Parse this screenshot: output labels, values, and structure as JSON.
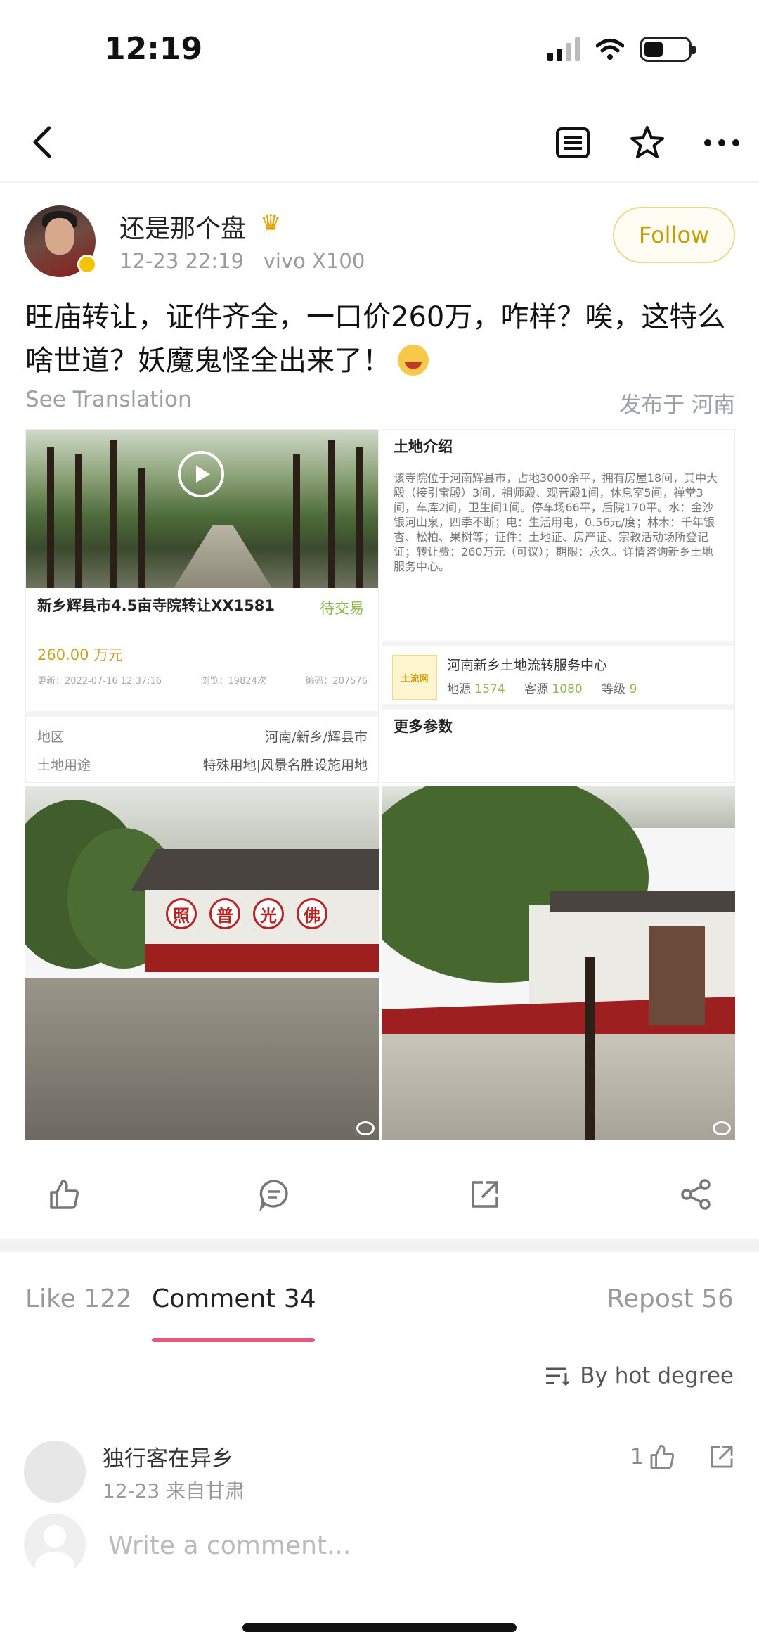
{
  "status_bar": {
    "time": "12:19"
  },
  "nav": {
    "back_icon": "chevron-left-icon",
    "icons": [
      "list-icon",
      "star-icon",
      "more-icon"
    ]
  },
  "author": {
    "name": "还是那个盘",
    "timestamp": "12-23 22:19",
    "device": "vivo X100",
    "follow_label": "Follow"
  },
  "post": {
    "text": "旺庙转让，证件齐全，一口价260万，咋样？唉，这特么啥世道？妖魔鬼怪全出来了！",
    "see_translation": "See Translation",
    "published_in": "发布于 河南"
  },
  "listing": {
    "title": "新乡辉县市4.5亩寺院转让XX1581",
    "status": "待交易",
    "price": "260.00 万元",
    "updated": "更新：2022-07-16 12:37:16",
    "views": "浏览：19824次",
    "code": "编码：207576",
    "region_label": "地区",
    "region_value": "河南/新乡/辉县市",
    "use_label": "土地用途",
    "use_value": "特殊用地|风景名胜设施用地"
  },
  "land_info": {
    "title": "土地介绍",
    "body": "该寺院位于河南辉县市，占地3000余平，拥有房屋18间，其中大殿（接引宝殿）3间，祖师殿、观音殿1间，休息室5间，禅堂3间，车库2间，卫生间1间。停车场66平，后院170平。水：金沙银河山泉，四季不断；电：生活用电，0.56元/度；林木：千年银杏、松柏、果树等；证件：土地证、房产证、宗教活动场所登记证；转让费：260万元（可议）；期限：永久。详情咨询新乡土地服务中心。",
    "center_logo": "土流网",
    "center_name": "河南新乡土地流转服务中心",
    "source_label": "地源",
    "source_value": "1574",
    "customer_label": "客源",
    "customer_value": "1080",
    "level_label": "等级",
    "level_value": "9",
    "more_params": "更多参数"
  },
  "photo_chars": [
    "照",
    "普",
    "光",
    "佛"
  ],
  "actions": [
    "like-icon",
    "comment-icon",
    "repost-icon",
    "share-icon"
  ],
  "tabs": {
    "like": "Like 122",
    "comment": "Comment 34",
    "repost": "Repost 56"
  },
  "sort_label": "By hot degree",
  "comment": {
    "name": "独行客在异乡",
    "meta": "12-23   来自甘肃",
    "likes": "1"
  },
  "write_comment": {
    "placeholder": "Write a comment..."
  },
  "colors": {
    "accent": "#e35a7a",
    "follow": "#c79d00",
    "status_green": "#8fb84e",
    "price_gold": "#c9a227"
  }
}
